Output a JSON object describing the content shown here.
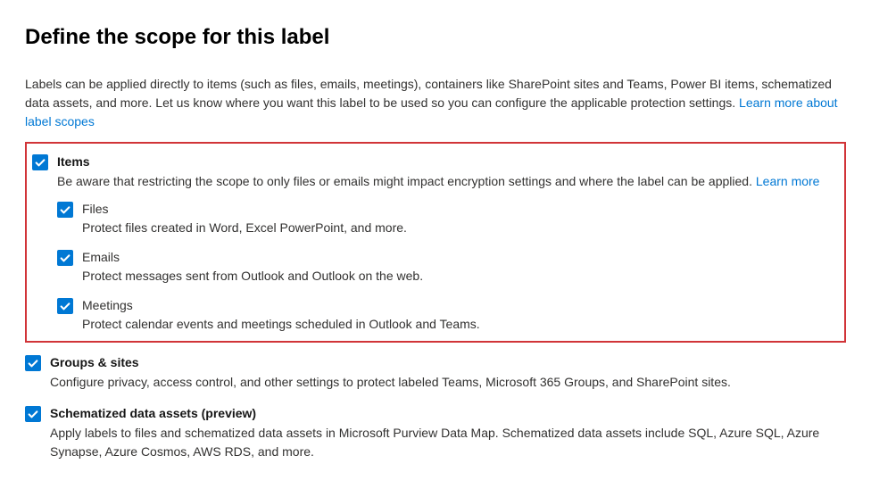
{
  "title": "Define the scope for this label",
  "intro_text": "Labels can be applied directly to items (such as files, emails, meetings), containers like SharePoint sites and Teams, Power BI items, schematized data assets, and more. Let us know where you want this label to be used so you can configure the applicable protection settings. ",
  "intro_link": "Learn more about label scopes",
  "items": {
    "title": "Items",
    "desc": "Be aware that restricting the scope to only files or emails might impact encryption settings and where the label can be applied. ",
    "learn_more": "Learn more",
    "sub": {
      "files": {
        "title": "Files",
        "desc": "Protect files created in Word, Excel PowerPoint, and more."
      },
      "emails": {
        "title": "Emails",
        "desc": "Protect messages sent from Outlook and Outlook on the web."
      },
      "meetings": {
        "title": "Meetings",
        "desc": "Protect calendar events and meetings scheduled in Outlook and Teams."
      }
    }
  },
  "groups": {
    "title": "Groups & sites",
    "desc": "Configure privacy, access control, and other settings to protect labeled Teams, Microsoft 365 Groups, and SharePoint sites."
  },
  "schematized": {
    "title": "Schematized data assets (preview)",
    "desc": "Apply labels to files and schematized data assets in Microsoft Purview Data Map. Schematized data assets include SQL, Azure SQL, Azure Synapse, Azure Cosmos, AWS RDS, and more."
  }
}
